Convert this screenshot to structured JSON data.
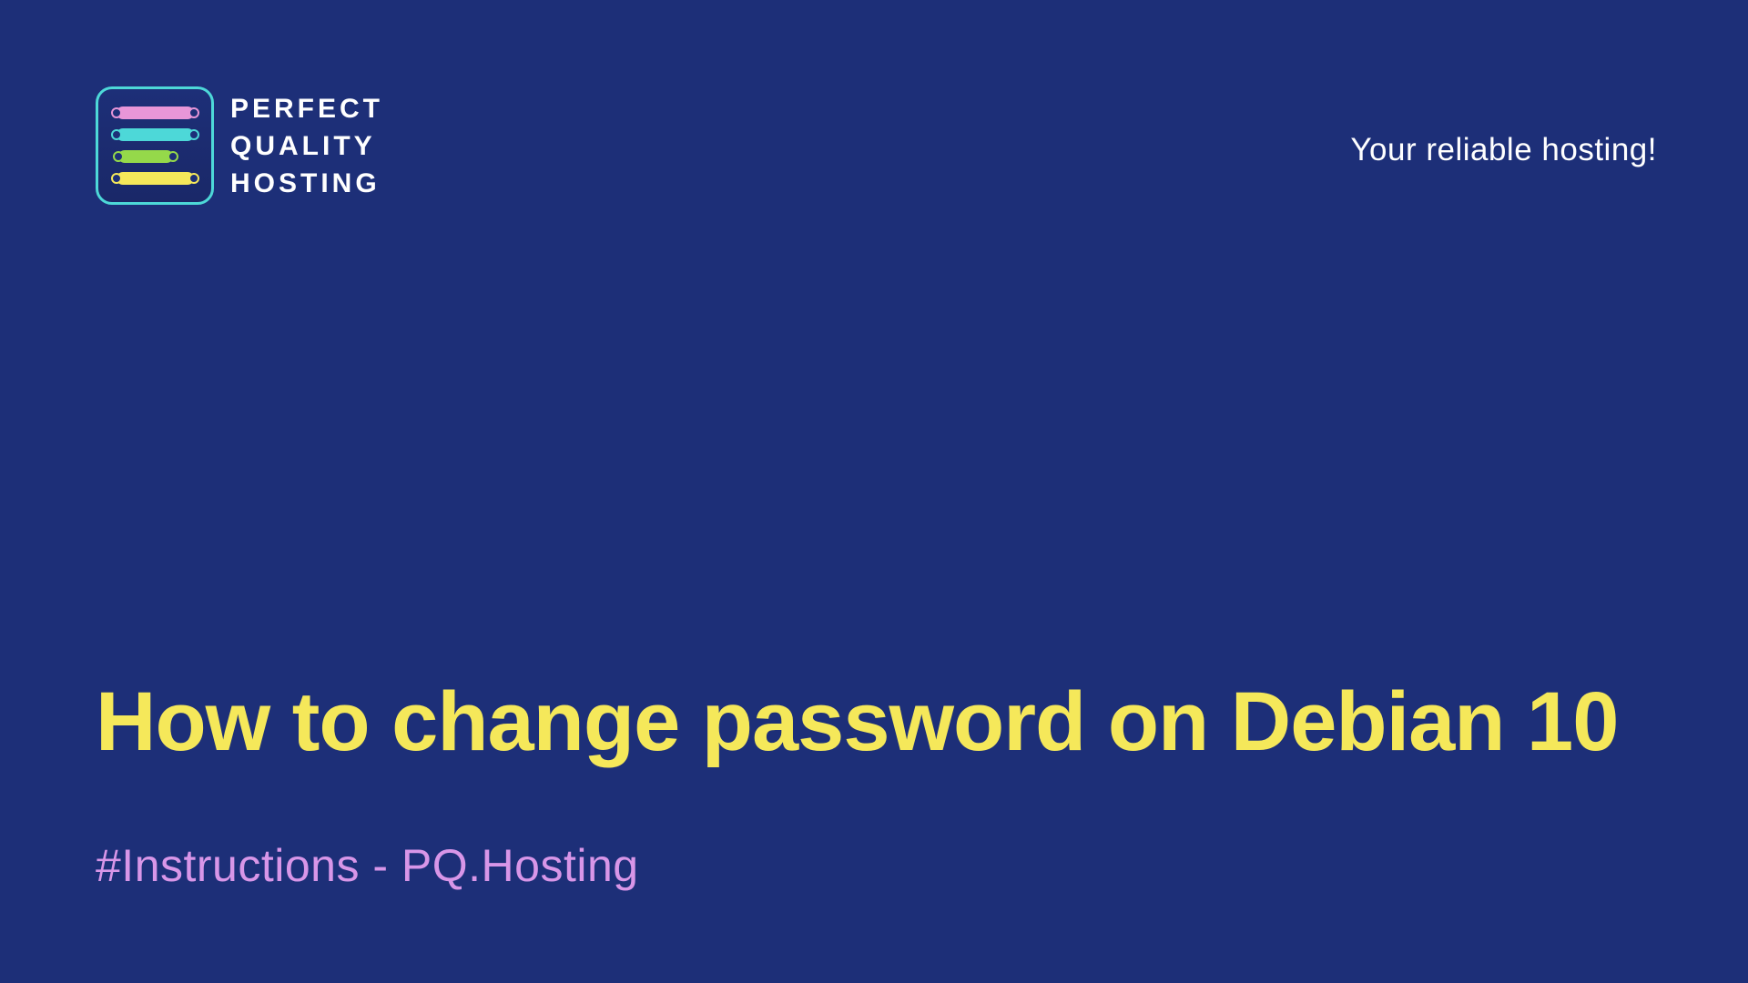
{
  "logo": {
    "line1": "PERFECT",
    "line2": "QUALITY",
    "line3": "HOSTING"
  },
  "tagline": "Your reliable hosting!",
  "title": "How to change password on Debian 10",
  "subtitle": "#Instructions - PQ.Hosting",
  "colors": {
    "background": "#1d2f78",
    "yellow": "#f5e85a",
    "purple": "#d896e8",
    "cyan": "#4dd8d8"
  }
}
